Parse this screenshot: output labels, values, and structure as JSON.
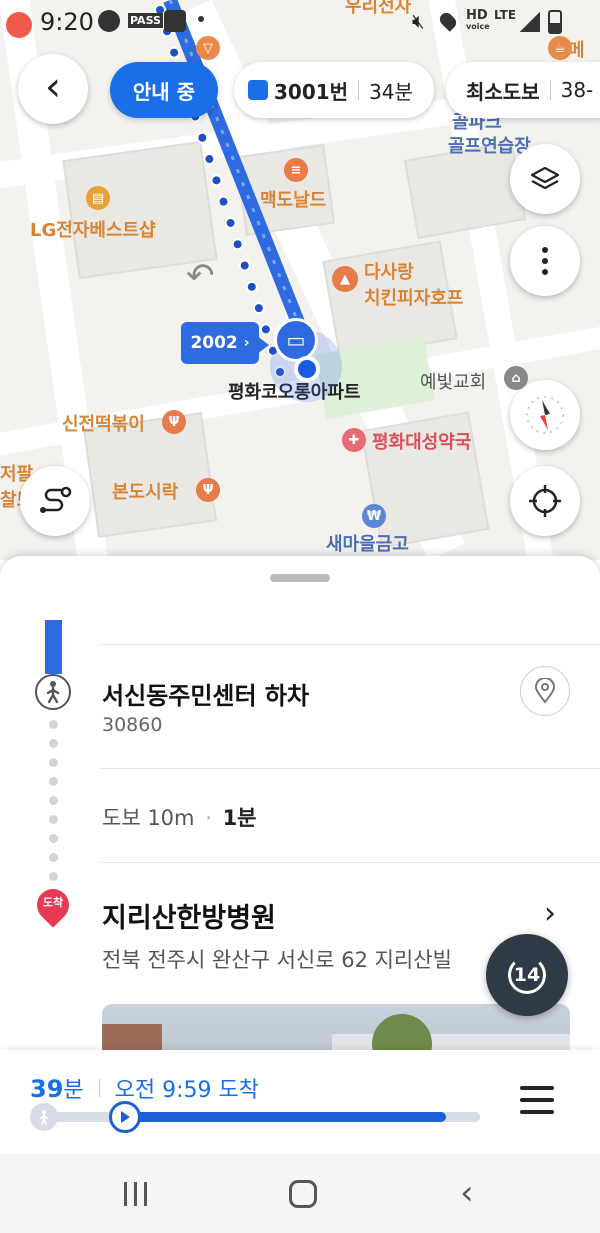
{
  "status_bar": {
    "time": "9:20",
    "pass_label": "PASS",
    "hd_label": "HD",
    "voice_label": "voice",
    "lte_label": "LTE"
  },
  "top_controls": {
    "guiding_label": "안내 중",
    "bus_number": "3001번",
    "bus_duration": "34분",
    "min_walk_label": "최소도보",
    "min_walk_value": "38-"
  },
  "map": {
    "labels": {
      "golf": "골프연습장",
      "golf_partial": "골파크",
      "mcdonalds": "맥도날드",
      "lg": "LG전자베스트샵",
      "dasarang_1": "다사랑",
      "dasarang_2": "치킨피자호프",
      "apartment": "평화코오롱아파트",
      "church": "예빛교회",
      "tteok": "신전떡볶이",
      "pharmacy": "평화대성약국",
      "bondosirak": "본도시락",
      "bank": "새마을금고",
      "left_partial_1": "저팔",
      "left_partial_2": "찰보",
      "top_partial": "우리전자",
      "top_right_partial": "메"
    },
    "bus_chip": "2002",
    "route_color": "#2e6be0"
  },
  "sheet": {
    "stop_name": "서신동주민센터 하차",
    "stop_id": "30860",
    "walk_label": "도보 10m",
    "walk_time": "1분",
    "arrival_badge": "도착",
    "destination_name": "지리산한방병원",
    "destination_address": "전북 전주시 완산구 서신로 62 지리산빌",
    "floating_badge": "14"
  },
  "bottom_bar": {
    "total_minutes": "39",
    "minutes_unit": "분",
    "arrival_time": "오전 9:59 도착",
    "progress_fraction": 0.21
  }
}
